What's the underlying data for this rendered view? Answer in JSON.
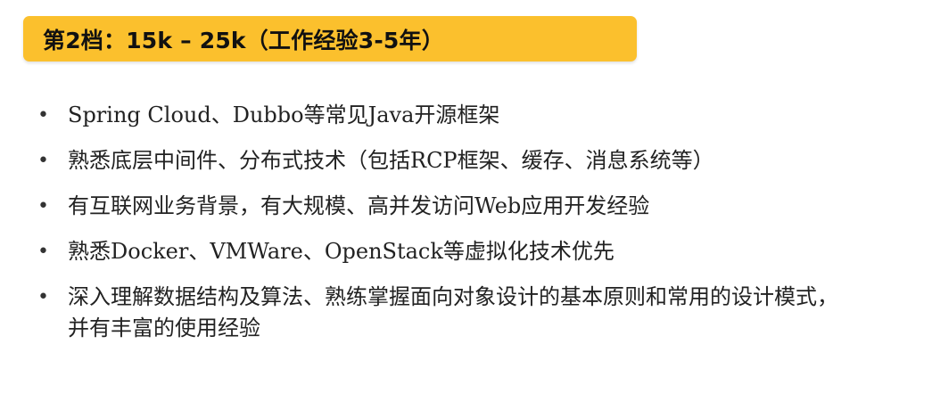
{
  "banner": {
    "title": "第2档：15k – 25k（工作经验3-5年）",
    "color": "#fbc02d"
  },
  "requirements": [
    "Spring Cloud、Dubbo等常见Java开源框架",
    "熟悉底层中间件、分布式技术（包括RCP框架、缓存、消息系统等）",
    "有互联网业务背景，有大规模、高并发访问Web应用开发经验",
    "熟悉Docker、VMWare、OpenStack等虚拟化技术优先",
    "深入理解数据结构及算法、熟练掌握面向对象设计的基本原则和常用的设计模式，并有丰富的使用经验"
  ]
}
